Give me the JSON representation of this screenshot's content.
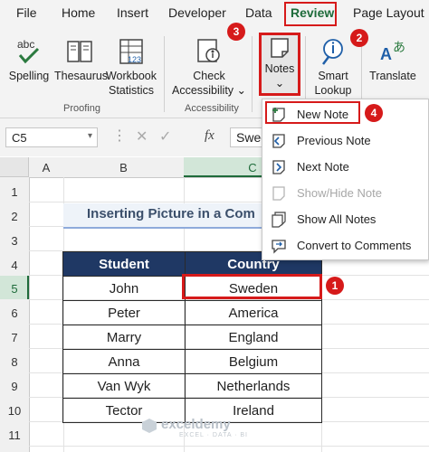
{
  "ribbon_tabs": [
    "File",
    "Home",
    "Insert",
    "Developer",
    "Data",
    "Review",
    "Page Layout"
  ],
  "active_tab": "Review",
  "proofing": {
    "spelling": "Spelling",
    "thesaurus": "Thesaurus",
    "workbook_statistics_1": "Workbook",
    "workbook_statistics_2": "Statistics",
    "group_label": "Proofing"
  },
  "accessibility": {
    "check_1": "Check",
    "check_2": "Accessibility",
    "group_label": "Accessibility"
  },
  "notes": {
    "label": "Notes"
  },
  "smart_lookup": {
    "line1": "Smart",
    "line2": "Lookup"
  },
  "translate": {
    "label": "Translate"
  },
  "formula_bar": {
    "name_box": "C5",
    "fx": "fx",
    "content": "Swed"
  },
  "grid": {
    "columns": [
      "A",
      "B",
      "C"
    ],
    "rows": [
      "1",
      "2",
      "3",
      "4",
      "5",
      "6",
      "7",
      "8",
      "9",
      "10",
      "11"
    ]
  },
  "sheet": {
    "title": "Inserting Picture in a Com",
    "headers": [
      "Student",
      "Country"
    ],
    "rows": [
      [
        "John",
        "Sweden"
      ],
      [
        "Peter",
        "America"
      ],
      [
        "Marry",
        "England"
      ],
      [
        "Anna",
        "Belgium"
      ],
      [
        "Van Wyk",
        "Netherlands"
      ],
      [
        "Tector",
        "Ireland"
      ]
    ]
  },
  "notes_menu": {
    "items": [
      "New Note",
      "Previous Note",
      "Next Note",
      "Show/Hide Note",
      "Show All Notes",
      "Convert to Comments"
    ],
    "disabled": [
      "Show/Hide Note"
    ]
  },
  "badges": [
    "1",
    "2",
    "3",
    "4"
  ],
  "watermark": {
    "name": "exceldemy",
    "tagline": "EXCEL · DATA · BI"
  },
  "colors": {
    "highlight_red": "#d61a1a",
    "table_header": "#1f3864",
    "excel_green": "#1e6b3a"
  }
}
